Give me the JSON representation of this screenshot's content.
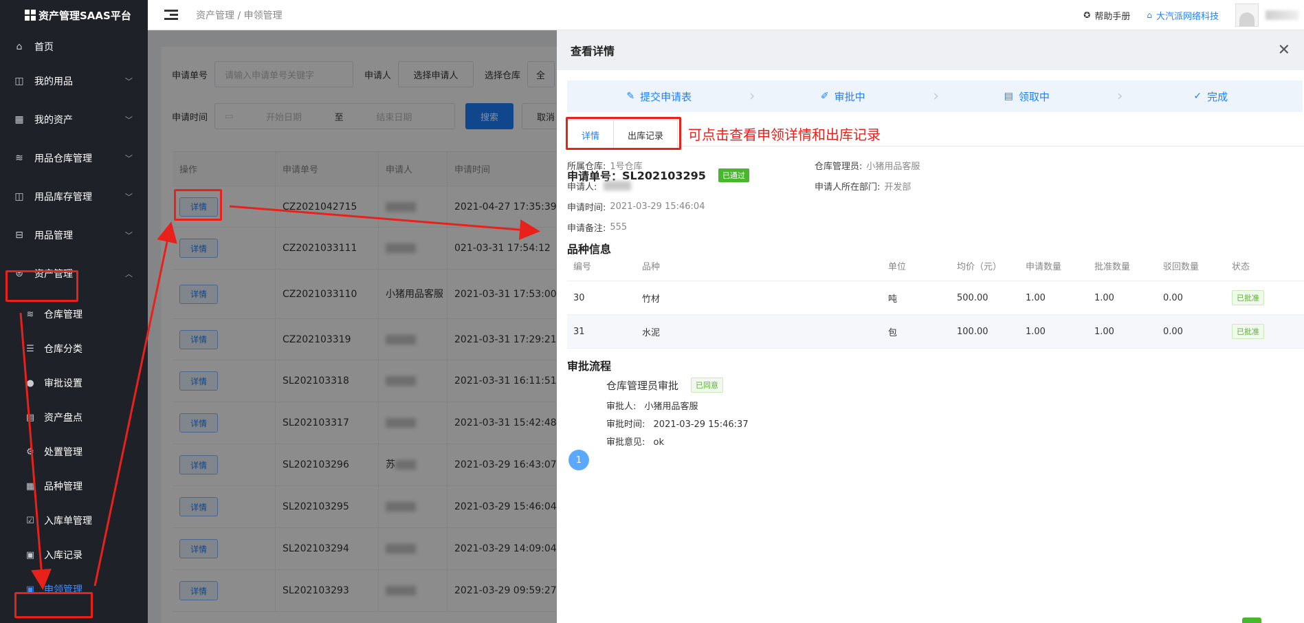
{
  "app": {
    "title": "资产管理SAAS平台"
  },
  "sidebar": {
    "items": [
      {
        "label": "首页",
        "icon": "home-icon"
      },
      {
        "label": "我的用品",
        "icon": "bag-icon"
      },
      {
        "label": "我的资产",
        "icon": "building-icon"
      },
      {
        "label": "用品仓库管理",
        "icon": "database-icon"
      },
      {
        "label": "用品库存管理",
        "icon": "box-icon"
      },
      {
        "label": "用品管理",
        "icon": "inbox-icon"
      },
      {
        "label": "资产管理",
        "icon": "asset-icon"
      }
    ],
    "sub_items": [
      {
        "label": "仓库管理",
        "icon": "database-icon"
      },
      {
        "label": "仓库分类",
        "icon": "sliders-icon"
      },
      {
        "label": "审批设置",
        "icon": "user-icon"
      },
      {
        "label": "资产盘点",
        "icon": "document-icon"
      },
      {
        "label": "处置管理",
        "icon": "gear-icon"
      },
      {
        "label": "品种管理",
        "icon": "grid-icon"
      },
      {
        "label": "入库单管理",
        "icon": "clipboard-check-icon"
      },
      {
        "label": "入库记录",
        "icon": "clipboard-icon"
      },
      {
        "label": "申领管理",
        "icon": "clipboard-list-icon"
      }
    ]
  },
  "header": {
    "breadcrumb": "资产管理 / 申领管理",
    "help": "帮助手册",
    "company": "大汽派网络科技"
  },
  "filters": {
    "app_no_label": "申请单号",
    "app_no_placeholder": "请输入申请单号关键字",
    "applicant_label": "申请人",
    "applicant_button": "选择申请人",
    "warehouse_label": "选择仓库",
    "warehouse_value": "全",
    "time_label": "申请时间",
    "start_placeholder": "开始日期",
    "range_sep": "至",
    "end_placeholder": "结束日期",
    "search_button": "搜索",
    "cancel_button": "取消"
  },
  "list": {
    "columns": [
      "操作",
      "申请单号",
      "申请人",
      "申请时间"
    ],
    "detail_label": "详情",
    "rows": [
      {
        "no": "CZ2021042715",
        "applicant": "",
        "time": "2021-04-27 17:35:39"
      },
      {
        "no": "CZ2021033111",
        "applicant": "",
        "time": "021-03-31 17:54:12"
      },
      {
        "no": "CZ2021033110",
        "applicant": "小猪用品客服",
        "time": "2021-03-31 17:53:00"
      },
      {
        "no": "CZ202103319",
        "applicant": "",
        "time": "2021-03-31 17:29:21"
      },
      {
        "no": "SL202103318",
        "applicant": "",
        "time": "2021-03-31 16:11:51"
      },
      {
        "no": "SL202103317",
        "applicant": "",
        "time": "2021-03-31 15:42:48"
      },
      {
        "no": "SL202103296",
        "applicant": "苏",
        "time": "2021-03-29 16:43:07"
      },
      {
        "no": "SL202103295",
        "applicant": "",
        "time": "2021-03-29 15:46:04"
      },
      {
        "no": "SL202103294",
        "applicant": "",
        "time": "2021-03-29 14:09:04"
      },
      {
        "no": "SL202103293",
        "applicant": "",
        "time": "2021-03-29 09:59:27"
      }
    ]
  },
  "drawer": {
    "title": "查看详情",
    "steps": [
      "提交申请表",
      "审批中",
      "领取中",
      "完成"
    ],
    "tabs": [
      "详情",
      "出库记录"
    ],
    "annotation": "可点击查看申领详情和出库记录",
    "app_no_label": "申请单号：",
    "app_no": "SL202103295",
    "status_badge": "已通过",
    "info": {
      "warehouse_label": "所属仓库:",
      "warehouse": "1号仓库",
      "manager_label": "仓库管理员:",
      "manager": "小猪用品客服",
      "applicant_label": "申请人:",
      "dept_label": "申请人所在部门:",
      "dept": "开发部",
      "time_label": "申请时间:",
      "time": "2021-03-29 15:46:04",
      "remark_label": "申请备注:",
      "remark": "555"
    },
    "variety_title": "品种信息",
    "variety_columns": [
      "编号",
      "品种",
      "单位",
      "均价（元）",
      "申请数量",
      "批准数量",
      "驳回数量",
      "状态"
    ],
    "variety_rows": [
      {
        "id": "30",
        "name": "竹材",
        "unit": "吨",
        "price": "500.00",
        "apply": "1.00",
        "approved": "1.00",
        "rejected": "0.00",
        "status": "已批准"
      },
      {
        "id": "31",
        "name": "水泥",
        "unit": "包",
        "price": "100.00",
        "apply": "1.00",
        "approved": "1.00",
        "rejected": "0.00",
        "status": "已批准"
      }
    ],
    "flow_title": "审批流程",
    "flow": {
      "step_no": "1",
      "name": "仓库管理员审批",
      "badge": "已同意",
      "approver_label": "审批人:",
      "approver": "小猪用品客服",
      "time_label": "审批时间:",
      "time": "2021-03-29 15:46:37",
      "opinion_label": "审批意见:",
      "opinion": "ok"
    }
  },
  "colors": {
    "accent": "#1e80ff",
    "sidebar_bg": "#1f2129",
    "annotation_red": "#e8211b",
    "success": "#49b72e"
  }
}
